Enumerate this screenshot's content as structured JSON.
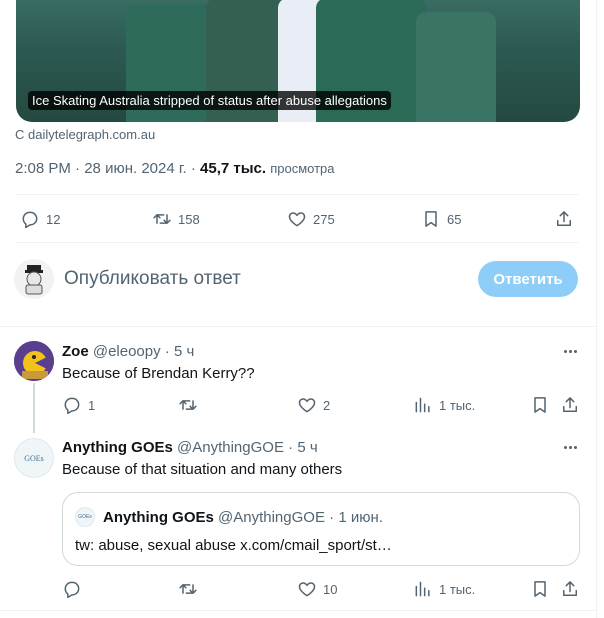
{
  "tweet": {
    "media_caption": "Ice Skating Australia stripped of status after abuse allegations",
    "source": "С dailytelegraph.com.au",
    "time": "2:08 PM",
    "sep1": "·",
    "date": "28 июн. 2024 г.",
    "sep2": "·",
    "views_count": "45,7 тыс.",
    "views_label": "просмотра",
    "actions": {
      "replies": "12",
      "retweets": "158",
      "likes": "275",
      "bookmarks": "65"
    }
  },
  "compose": {
    "placeholder": "Опубликовать ответ",
    "button_label": "Ответить"
  },
  "replies": [
    {
      "name": "Zoe",
      "handle": "@eleoopy",
      "dot": "·",
      "time": "5 ч",
      "text": "Because of Brendan Kerry??",
      "actions": {
        "replies": "1",
        "retweets": "",
        "likes": "2",
        "views": "1 тыс."
      }
    },
    {
      "name": "Anything GOEs",
      "handle": "@AnythingGOE",
      "dot": "·",
      "time": "5 ч",
      "text": "Because of that situation and many others",
      "avatar_text": "GOEs",
      "quote": {
        "name": "Anything GOEs",
        "handle": "@AnythingGOE",
        "dot": "·",
        "time": "1 июн.",
        "text": "tw: abuse, sexual abuse x.com/cmail_sport/st…",
        "avatar_text": "GOEs"
      },
      "actions": {
        "replies": "",
        "retweets": "",
        "likes": "10",
        "views": "1 тыс."
      }
    }
  ],
  "colors": {
    "accent_disabled": "#8ecdf7",
    "text_primary": "#0f1419",
    "text_secondary": "#536471",
    "divider": "#eff3f4"
  },
  "icons": [
    "reply-icon",
    "retweet-icon",
    "like-icon",
    "bookmark-icon",
    "share-icon",
    "views-icon",
    "more-icon"
  ]
}
